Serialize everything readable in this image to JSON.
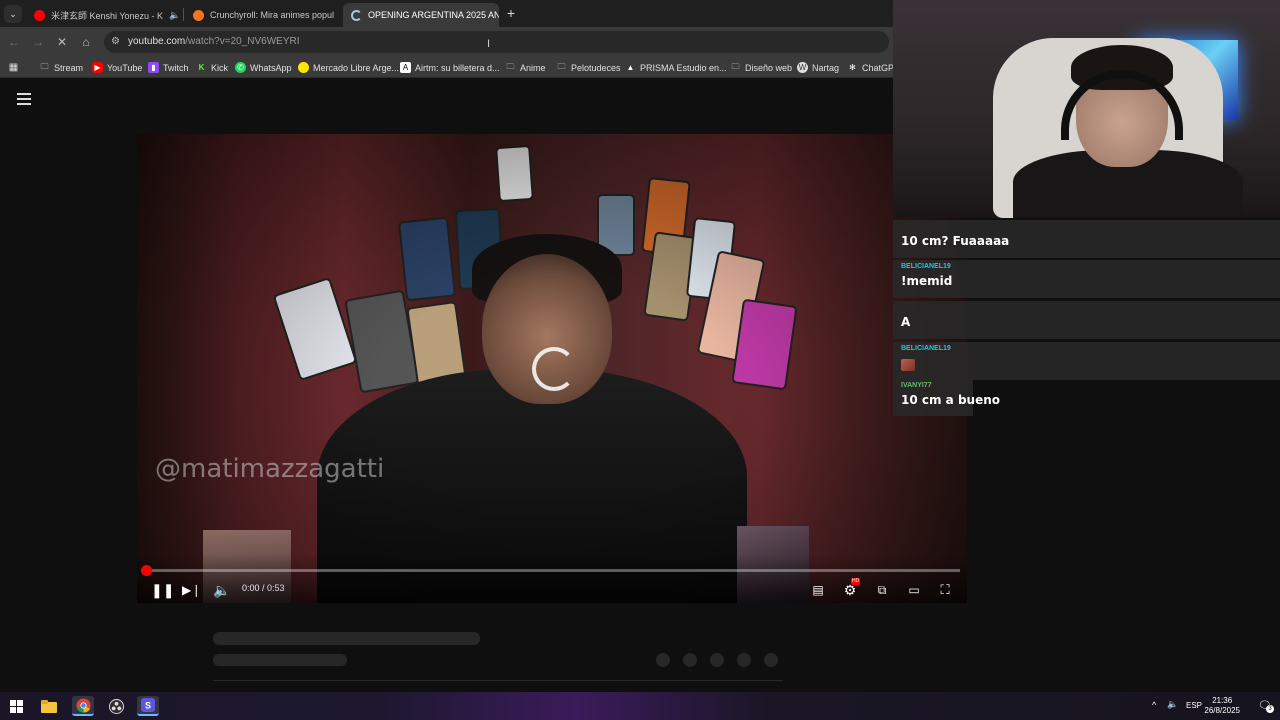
{
  "tabs": [
    {
      "title": "米津玄師 Kenshi Yonezu - K",
      "audio": true,
      "favicon_color": "#ff0000"
    },
    {
      "title": "Crunchyroll: Mira animes popul",
      "audio": false,
      "favicon_color": "#f47521"
    },
    {
      "title": "OPENING ARGENTINA 2025 AN",
      "audio": false,
      "favicon_color": "#9ad1d4",
      "active": true
    }
  ],
  "address": {
    "host": "youtube.com",
    "path": "/watch?v=20_NV6WEYRI"
  },
  "bookmarks": [
    {
      "label": "Stream",
      "icon": "folder-icon"
    },
    {
      "label": "YouTube",
      "icon": "youtube-icon",
      "color": "#ff0000"
    },
    {
      "label": "Twitch",
      "icon": "twitch-icon",
      "color": "#9146ff"
    },
    {
      "label": "Kick",
      "icon": "kick-icon",
      "color": "#53fc18"
    },
    {
      "label": "WhatsApp",
      "icon": "whatsapp-icon",
      "color": "#25d366"
    },
    {
      "label": "Mercado Libre Arge...",
      "icon": "mercadolibre-icon",
      "color": "#ffe600"
    },
    {
      "label": "Airtm: su billetera d...",
      "icon": "airtm-icon",
      "color": "#ffffff"
    },
    {
      "label": "Anime",
      "icon": "folder-icon"
    },
    {
      "label": "Pelotudeces",
      "icon": "folder-icon"
    },
    {
      "label": "PRISMA Estudio en...",
      "icon": "prisma-icon",
      "color": "#ffffff"
    },
    {
      "label": "Diseño web",
      "icon": "folder-icon"
    },
    {
      "label": "Nartag",
      "icon": "wordpress-icon",
      "color": "#ffffff"
    },
    {
      "label": "ChatGPT",
      "icon": "chatgpt-icon",
      "color": "#ffffff"
    }
  ],
  "video": {
    "watermark": "@matimazzagatti",
    "time_current": "0:00",
    "time_separator": " / ",
    "time_duration": "0:53",
    "progress_fraction": 0.0,
    "hd_badge": "HD"
  },
  "chat": [
    {
      "user": "",
      "user_color": "#e53935",
      "text": "10 cm? Fuaaaaa"
    },
    {
      "user": "BELICIANEL19",
      "user_color": "#26c6da",
      "text": "!memid"
    },
    {
      "user": "",
      "user_color": "#e53935",
      "text": "A"
    },
    {
      "user": "BELICIANEL19",
      "user_color": "#26c6da",
      "text": "",
      "emote": true
    },
    {
      "user": "IVANYI77",
      "user_color": "#66bb6a",
      "text": "10 cm a bueno"
    }
  ],
  "taskbar": {
    "language": "ESP",
    "time": "21:36",
    "date": "26/8/2025",
    "notifications": "3"
  },
  "colors": {
    "accent_red": "#ff0000",
    "chrome_bg": "#3a3a3a",
    "page_bg": "#0f0f0f"
  }
}
